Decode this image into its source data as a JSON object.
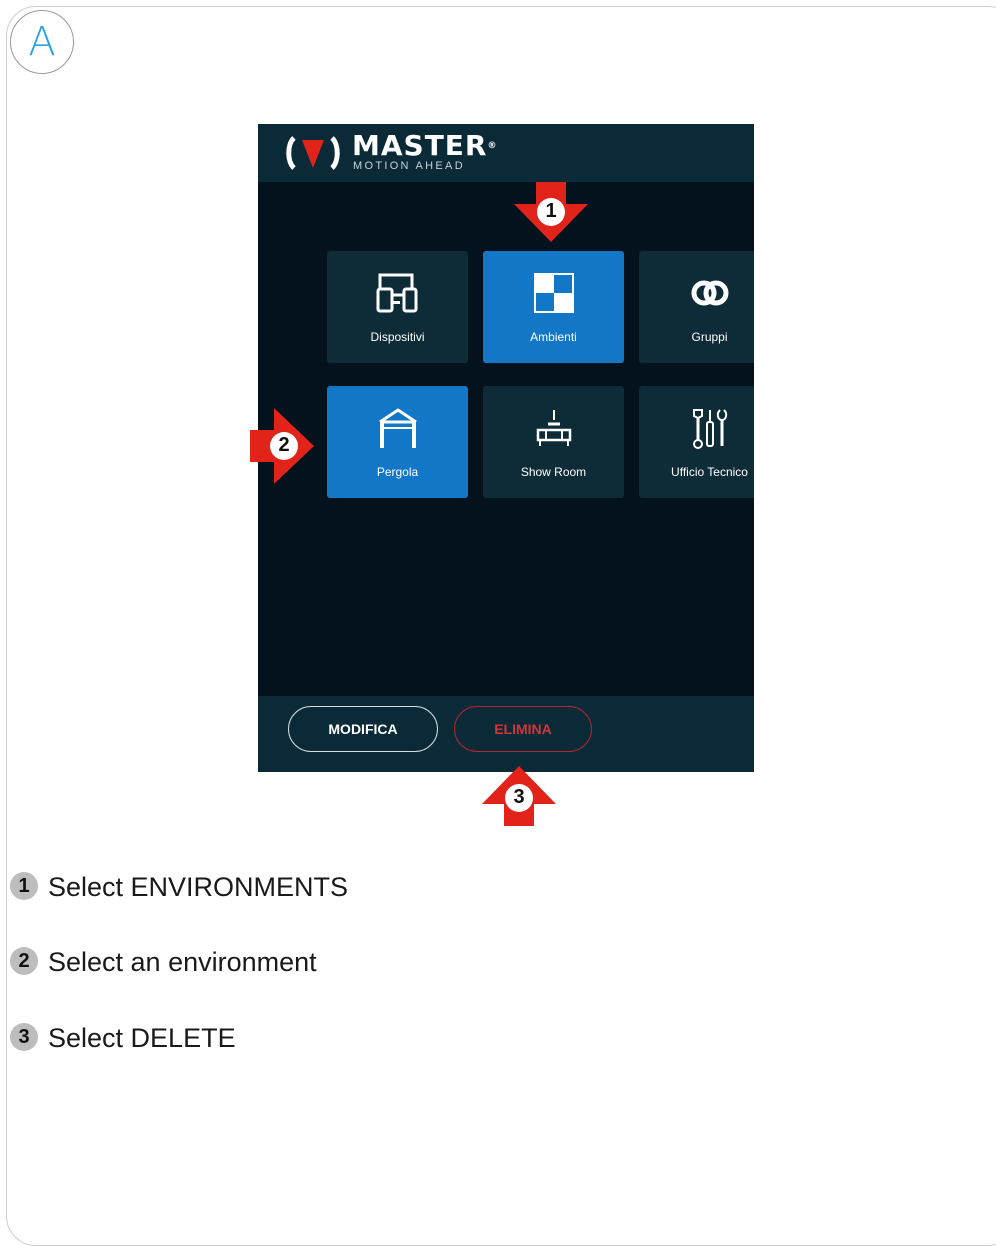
{
  "step_letter": "A",
  "app": {
    "brand": "MASTER",
    "brand_mark": "®",
    "tagline": "MOTION AHEAD",
    "tiles": [
      {
        "label": "Dispositivi",
        "icon": "devices-icon",
        "active": false
      },
      {
        "label": "Ambienti",
        "icon": "environments-icon",
        "active": true
      },
      {
        "label": "Gruppi",
        "icon": "groups-icon",
        "active": false
      },
      {
        "label": "Pergola",
        "icon": "pergola-icon",
        "active": true
      },
      {
        "label": "Show Room",
        "icon": "sofa-lamp-icon",
        "active": false
      },
      {
        "label": "Ufficio Tecnico",
        "icon": "tools-icon",
        "active": false
      }
    ],
    "buttons": {
      "edit": "MODIFICA",
      "delete": "ELIMINA"
    }
  },
  "callouts": [
    "1",
    "2",
    "3"
  ],
  "legend": [
    {
      "num": "1",
      "text": "Select ENVIRONMENTS"
    },
    {
      "num": "2",
      "text": "Select an environment"
    },
    {
      "num": "3",
      "text": "Select DELETE"
    }
  ],
  "colors": {
    "accent_blue": "#1177c6",
    "arrow_red": "#e2231a",
    "delete_red": "#d3343a",
    "screen_bg": "#03121d",
    "header_bg": "#0a2a38",
    "tile_bg": "#0e2b38"
  }
}
